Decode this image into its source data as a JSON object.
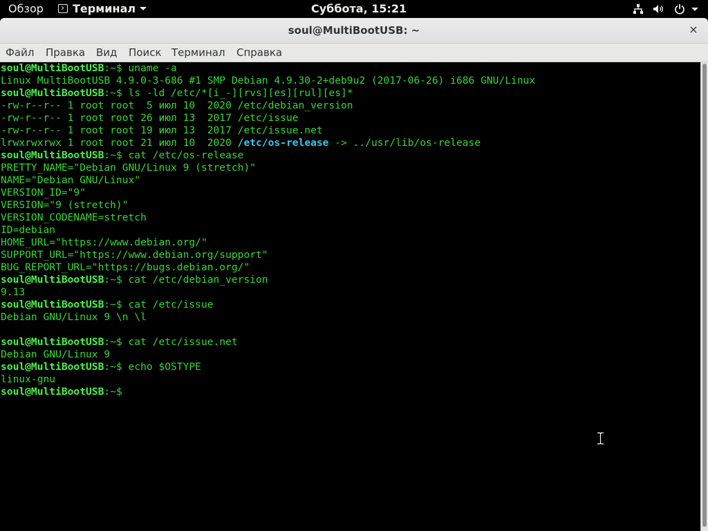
{
  "topbar": {
    "activities": "Обзор",
    "app_menu": "Терминал",
    "clock": "Суббота, 15:21",
    "tray_icons": [
      "network-icon",
      "volume-icon",
      "power-icon"
    ]
  },
  "window": {
    "title": "soul@MultiBootUSB: ~",
    "close_glyph": "×"
  },
  "menubar": [
    "Файл",
    "Правка",
    "Вид",
    "Поиск",
    "Терминал",
    "Справка"
  ],
  "terminal": {
    "prompt": "soul@MultiBootUSB",
    "prompt_suffix": ":~$",
    "lines": [
      {
        "type": "cmd",
        "text": " uname -a"
      },
      {
        "type": "out",
        "text": "Linux MultiBootUSB 4.9.0-3-686 #1 SMP Debian 4.9.30-2+deb9u2 (2017-06-26) i686 GNU/Linux"
      },
      {
        "type": "cmd",
        "text": " ls -ld /etc/*[i_-][rvs][es][rul][es]*"
      },
      {
        "type": "out",
        "text": "-rw-r--r-- 1 root root  5 июл 10  2020 /etc/debian_version"
      },
      {
        "type": "out",
        "text": "-rw-r--r-- 1 root root 26 июл 13  2017 /etc/issue"
      },
      {
        "type": "out",
        "text": "-rw-r--r-- 1 root root 19 июл 13  2017 /etc/issue.net"
      },
      {
        "type": "link",
        "pre": "lrwxrwxrwx 1 root root 21 июл 10  2020 ",
        "hl": "/etc/os-release",
        "post": " -> ../usr/lib/os-release"
      },
      {
        "type": "cmd",
        "text": " cat /etc/os-release"
      },
      {
        "type": "out",
        "text": "PRETTY_NAME=\"Debian GNU/Linux 9 (stretch)\""
      },
      {
        "type": "out",
        "text": "NAME=\"Debian GNU/Linux\""
      },
      {
        "type": "out",
        "text": "VERSION_ID=\"9\""
      },
      {
        "type": "out",
        "text": "VERSION=\"9 (stretch)\""
      },
      {
        "type": "out",
        "text": "VERSION_CODENAME=stretch"
      },
      {
        "type": "out",
        "text": "ID=debian"
      },
      {
        "type": "out",
        "text": "HOME_URL=\"https://www.debian.org/\""
      },
      {
        "type": "out",
        "text": "SUPPORT_URL=\"https://www.debian.org/support\""
      },
      {
        "type": "out",
        "text": "BUG_REPORT_URL=\"https://bugs.debian.org/\""
      },
      {
        "type": "cmd",
        "text": " cat /etc/debian_version"
      },
      {
        "type": "out",
        "text": "9.13"
      },
      {
        "type": "cmd",
        "text": " cat /etc/issue"
      },
      {
        "type": "out",
        "text": "Debian GNU/Linux 9 \\n \\l"
      },
      {
        "type": "out",
        "text": ""
      },
      {
        "type": "cmd",
        "text": " cat /etc/issue.net"
      },
      {
        "type": "out",
        "text": "Debian GNU/Linux 9"
      },
      {
        "type": "cmd",
        "text": " echo $OSTYPE"
      },
      {
        "type": "out",
        "text": "linux-gnu"
      },
      {
        "type": "cmd",
        "text": " "
      }
    ]
  },
  "colors": {
    "terminal_fg": "#37d737",
    "prompt": "#4bf04b",
    "symlink": "#3fc4f0",
    "background": "#000000"
  }
}
